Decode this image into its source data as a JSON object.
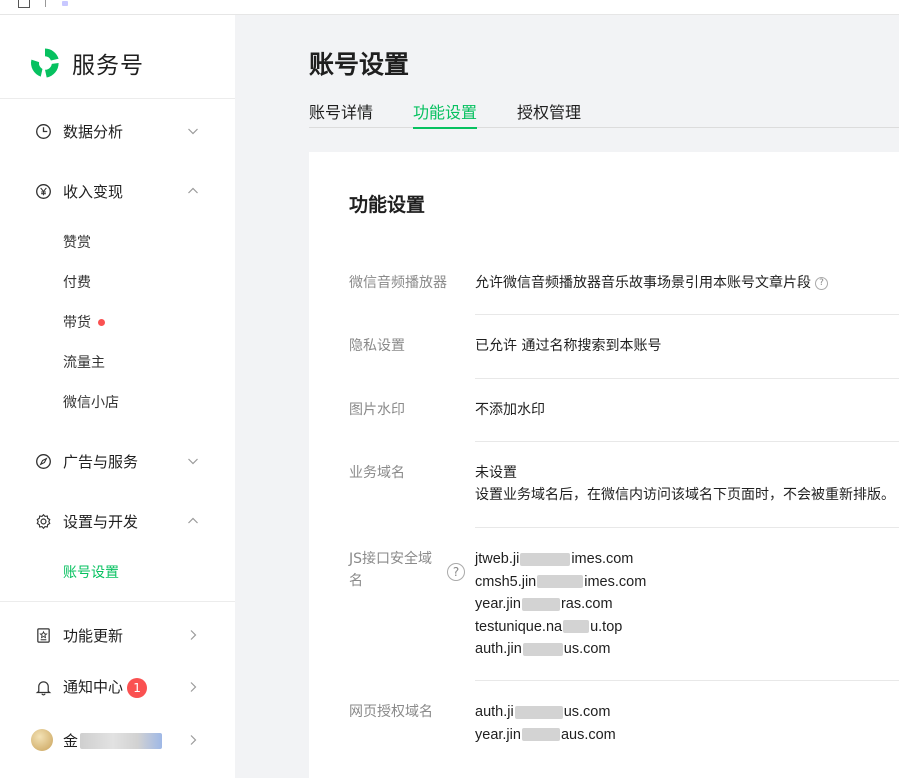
{
  "brand": {
    "name": "服务号",
    "accent": "#07c160"
  },
  "sidebar": {
    "items": [
      {
        "label": "数据分析",
        "icon": "clock-pie-icon",
        "expanded": false
      },
      {
        "label": "收入变现",
        "icon": "yen-icon",
        "expanded": true,
        "children": [
          {
            "label": "赞赏"
          },
          {
            "label": "付费"
          },
          {
            "label": "带货",
            "dot": true
          },
          {
            "label": "流量主"
          },
          {
            "label": "微信小店"
          }
        ]
      },
      {
        "label": "广告与服务",
        "icon": "compass-icon",
        "expanded": false
      },
      {
        "label": "设置与开发",
        "icon": "gear-icon",
        "expanded": true,
        "children": [
          {
            "label": "账号设置",
            "active": true
          }
        ]
      },
      {
        "label": "功能更新",
        "icon": "update-icon"
      },
      {
        "label": "通知中心",
        "icon": "bell-icon",
        "badge": "1"
      },
      {
        "label": "金",
        "icon": "avatar"
      }
    ]
  },
  "header": {
    "title": "账号设置"
  },
  "tabs": [
    {
      "label": "账号详情",
      "active": false
    },
    {
      "label": "功能设置",
      "active": true
    },
    {
      "label": "授权管理",
      "active": false
    }
  ],
  "panel": {
    "title": "功能设置",
    "rows": [
      {
        "label": "微信音频播放器",
        "value": "允许微信音频播放器音乐故事场景引用本账号文章片段"
      },
      {
        "label": "隐私设置",
        "value": "已允许 通过名称搜索到本账号"
      },
      {
        "label": "图片水印",
        "value": "不添加水印"
      },
      {
        "label": "业务域名",
        "value": "未设置",
        "desc": "设置业务域名后，在微信内访问该域名下页面时，不会被重新排版。"
      },
      {
        "label_line1": "JS接口安全域",
        "label_line2": "名",
        "domains": [
          {
            "pre": "jtweb.ji",
            "post": "imes.com"
          },
          {
            "pre": "cmsh5.jin",
            "post": "imes.com"
          },
          {
            "pre": "year.jin",
            "post": "ras.com"
          },
          {
            "pre": "testunique.na",
            "post": "u.top"
          },
          {
            "pre": "auth.jin",
            "post": "us.com"
          }
        ]
      },
      {
        "label": "网页授权域名",
        "domains": [
          {
            "pre": "auth.ji",
            "post": "us.com"
          },
          {
            "pre": "year.jin",
            "post": "aus.com"
          }
        ]
      }
    ]
  }
}
